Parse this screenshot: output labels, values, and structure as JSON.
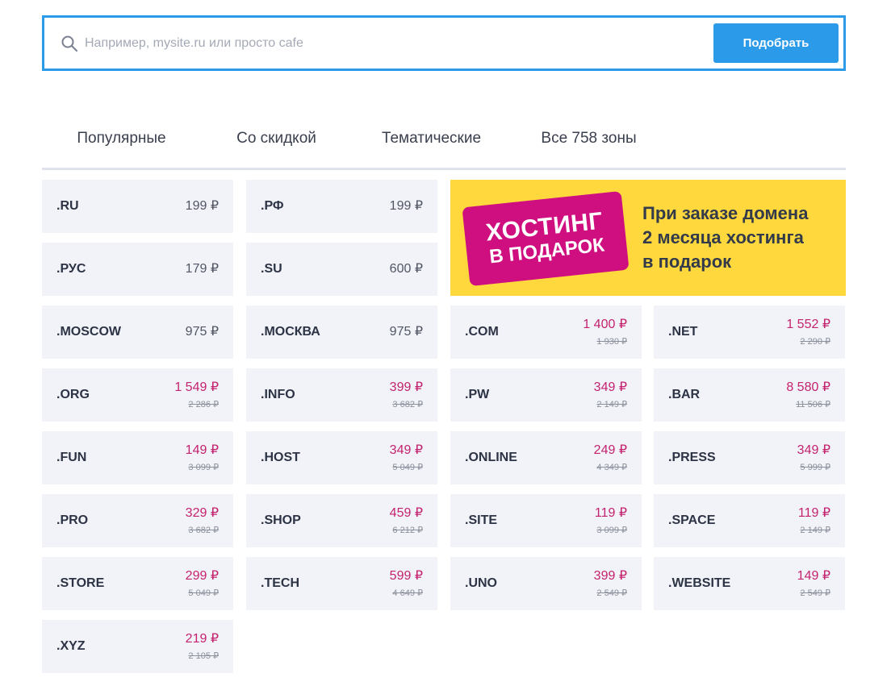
{
  "search": {
    "placeholder": "Например, mysite.ru или просто cafe",
    "button_label": "Подобрать"
  },
  "tabs": [
    {
      "label": "Популярные",
      "active": true
    },
    {
      "label": "Со скидкой",
      "active": false
    },
    {
      "label": "Тематические",
      "active": false
    },
    {
      "label": "Все 758 зоны",
      "active": false
    }
  ],
  "promo": {
    "badge_line1": "ХОСТИНГ",
    "badge_line2": "В ПОДАРОК",
    "line1": "При заказе домена",
    "line2": "2 месяца хостинга",
    "line3": "в подарок"
  },
  "zones": [
    {
      "name": ".RU",
      "price": "199 ₽"
    },
    {
      "name": ".РФ",
      "price": "199 ₽"
    },
    {
      "name": ".РУС",
      "price": "179 ₽"
    },
    {
      "name": ".SU",
      "price": "600 ₽"
    },
    {
      "name": ".MOSCOW",
      "price": "975 ₽"
    },
    {
      "name": ".МОСКВА",
      "price": "975 ₽"
    },
    {
      "name": ".COM",
      "price": "1 400 ₽",
      "old_price": "1 930 ₽"
    },
    {
      "name": ".NET",
      "price": "1 552 ₽",
      "old_price": "2 290 ₽"
    },
    {
      "name": ".ORG",
      "price": "1 549 ₽",
      "old_price": "2 286 ₽"
    },
    {
      "name": ".INFO",
      "price": "399 ₽",
      "old_price": "3 682 ₽"
    },
    {
      "name": ".PW",
      "price": "349 ₽",
      "old_price": "2 149 ₽"
    },
    {
      "name": ".BAR",
      "price": "8 580 ₽",
      "old_price": "11 506 ₽"
    },
    {
      "name": ".FUN",
      "price": "149 ₽",
      "old_price": "3 099 ₽"
    },
    {
      "name": ".HOST",
      "price": "349 ₽",
      "old_price": "5 049 ₽"
    },
    {
      "name": ".ONLINE",
      "price": "249 ₽",
      "old_price": "4 349 ₽"
    },
    {
      "name": ".PRESS",
      "price": "349 ₽",
      "old_price": "5 999 ₽"
    },
    {
      "name": ".PRO",
      "price": "329 ₽",
      "old_price": "3 682 ₽"
    },
    {
      "name": ".SHOP",
      "price": "459 ₽",
      "old_price": "6 212 ₽"
    },
    {
      "name": ".SITE",
      "price": "119 ₽",
      "old_price": "3 099 ₽"
    },
    {
      "name": ".SPACE",
      "price": "119 ₽",
      "old_price": "2 149 ₽"
    },
    {
      "name": ".STORE",
      "price": "299 ₽",
      "old_price": "5 049 ₽"
    },
    {
      "name": ".TECH",
      "price": "599 ₽",
      "old_price": "4 649 ₽"
    },
    {
      "name": ".UNO",
      "price": "399 ₽",
      "old_price": "2 549 ₽"
    },
    {
      "name": ".WEBSITE",
      "price": "149 ₽",
      "old_price": "2 549 ₽"
    },
    {
      "name": ".XYZ",
      "price": "219 ₽",
      "old_price": "2 105 ₽"
    }
  ],
  "colors": {
    "accent": "#2b9ae8",
    "discount_price": "#c4226f",
    "promo_background": "#ffd83d",
    "promo_badge": "#cf0f7f",
    "card_background": "#f2f3f8"
  },
  "icons": {
    "search": "search-icon"
  }
}
